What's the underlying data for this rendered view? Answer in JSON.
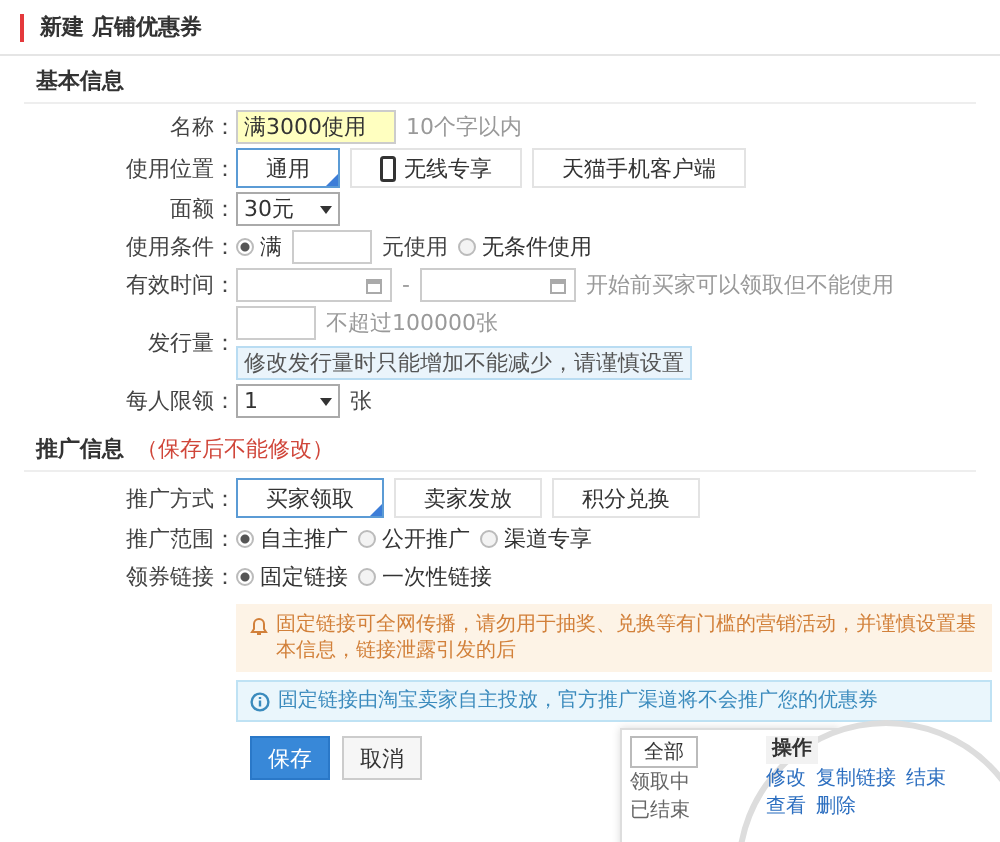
{
  "title": "新建 店铺优惠券",
  "basic": {
    "heading": "基本信息",
    "fields": [
      {
        "kind": "text",
        "label": "名称：",
        "value": "满3000使用",
        "hint": "10个字以内"
      },
      {
        "kind": "options",
        "label": "使用位置：",
        "options": [
          {
            "label": "通用",
            "selected": true,
            "kind": "plain"
          },
          {
            "label": "无线专享",
            "selected": false,
            "kind": "device"
          },
          {
            "label": "天猫手机客户端",
            "selected": false,
            "kind": "plain"
          }
        ]
      },
      {
        "kind": "select",
        "label": "面额：",
        "value": "30元"
      },
      {
        "kind": "condition",
        "label": "使用条件：",
        "choices": [
          {
            "label": "满",
            "selected": true
          },
          {
            "label": "无条件使用",
            "selected": false
          }
        ],
        "unit": "元使用"
      },
      {
        "kind": "daterange",
        "label": "有效时间：",
        "separator": "-",
        "hint": "开始前买家可以领取但不能使用"
      },
      {
        "kind": "quantity",
        "label": "发行量：",
        "hint": "不超过100000张",
        "notice": "修改发行量时只能增加不能减少，请谨慎设置"
      },
      {
        "kind": "select",
        "label": "每人限领：",
        "value": "1",
        "unit": "张"
      }
    ]
  },
  "promo": {
    "heading": "推广信息",
    "note": "（保存后不能修改）",
    "fields": [
      {
        "kind": "options",
        "label": "推广方式：",
        "options": [
          {
            "label": "买家领取",
            "selected": true,
            "kind": "plain"
          },
          {
            "label": "卖家发放",
            "selected": false,
            "kind": "plain"
          },
          {
            "label": "积分兑换",
            "selected": false,
            "kind": "plain"
          }
        ]
      },
      {
        "kind": "radios",
        "label": "推广范围：",
        "choices": [
          {
            "label": "自主推广",
            "selected": true
          },
          {
            "label": "公开推广",
            "selected": false
          },
          {
            "label": "渠道专享",
            "selected": false
          }
        ]
      },
      {
        "kind": "radios",
        "label": "领券链接：",
        "choices": [
          {
            "label": "固定链接",
            "selected": true
          },
          {
            "label": "一次性链接",
            "selected": false
          }
        ]
      }
    ]
  },
  "alerts": [
    {
      "kind": "warning",
      "text": "固定链接可全网传播，请勿用于抽奖、兑换等有门槛的营销活动，并谨慎设置基本信息，链接泄露引发的后"
    },
    {
      "kind": "info",
      "text": "固定链接由淘宝卖家自主投放，官方推广渠道将不会推广您的优惠券"
    }
  ],
  "buttons": [
    {
      "label": "保存",
      "kind": "primary"
    },
    {
      "label": "取消",
      "kind": "default"
    }
  ],
  "inset": {
    "filter": "全部",
    "statuses": [
      "领取中",
      "已结束"
    ],
    "column": "操作",
    "actions": [
      [
        "修改",
        "复制链接",
        "结束"
      ],
      [
        "查看",
        "删除"
      ]
    ]
  }
}
